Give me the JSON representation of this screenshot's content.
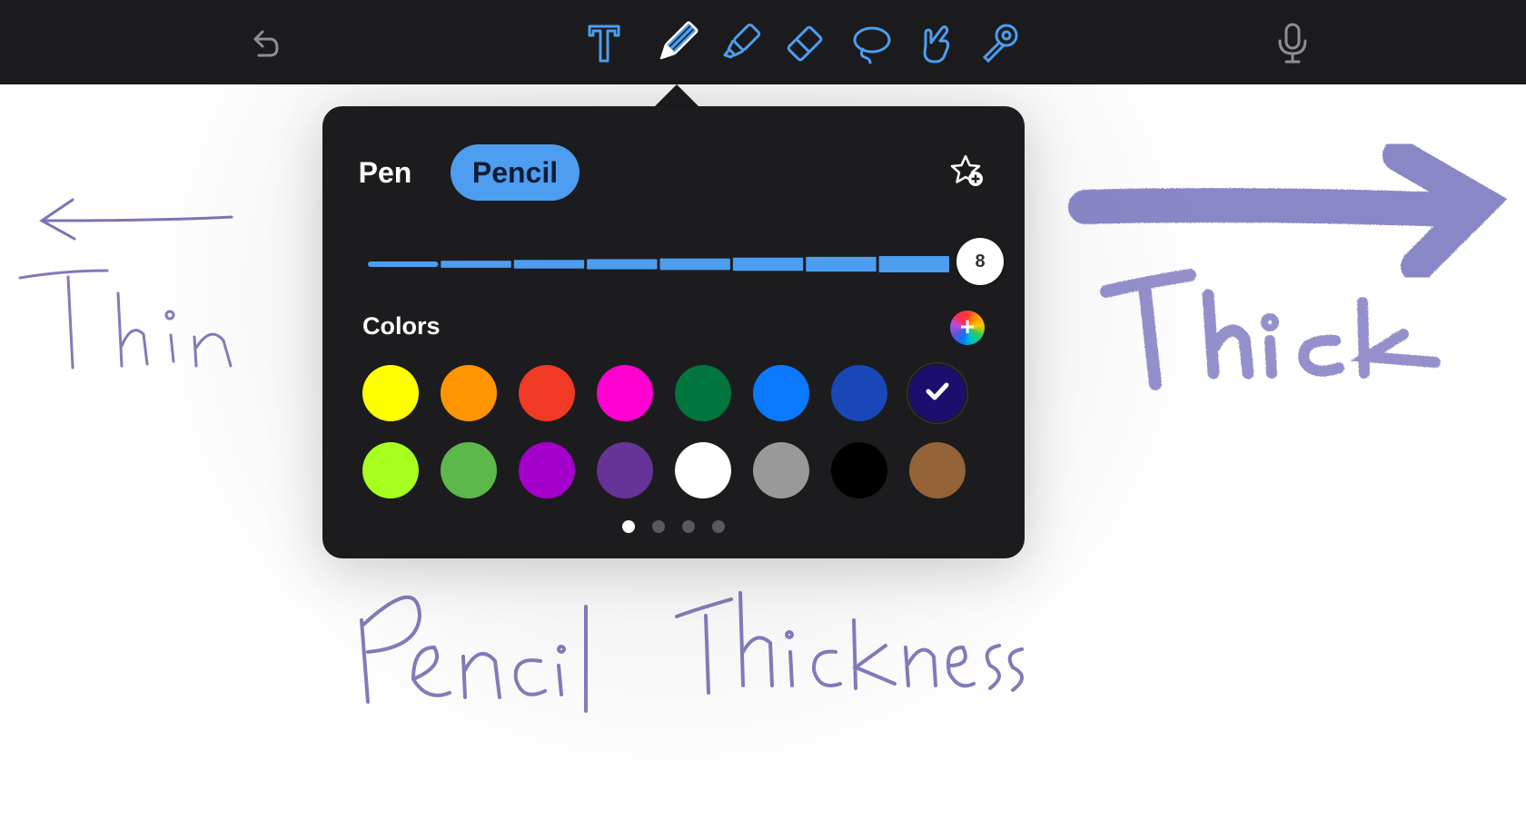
{
  "toolbar": {
    "items": [
      {
        "name": "undo-icon"
      },
      {
        "name": "text-tool-icon"
      },
      {
        "name": "pencil-tool-icon",
        "active": true
      },
      {
        "name": "highlighter-tool-icon"
      },
      {
        "name": "eraser-tool-icon"
      },
      {
        "name": "lasso-tool-icon"
      },
      {
        "name": "hand-tool-icon"
      },
      {
        "name": "laser-pointer-icon"
      },
      {
        "name": "microphone-icon"
      }
    ],
    "accent_color": "#4d9df0"
  },
  "popover": {
    "segments": {
      "pen": "Pen",
      "pencil": "Pencil",
      "selected": "pencil"
    },
    "favorite_icon": "star-plus-icon",
    "thickness": {
      "value": "8",
      "min": 1,
      "max": 8,
      "steps": 8
    },
    "colors_label": "Colors",
    "add_color_icon": "color-wheel-plus-icon",
    "swatches": [
      "#ffff00",
      "#ff9500",
      "#f03a24",
      "#ff00d0",
      "#00753d",
      "#0a78ff",
      "#1a47b8",
      "#1a0f6f",
      "#a6ff1f",
      "#5cb84a",
      "#a400cc",
      "#663399",
      "#ffffff",
      "#999999",
      "#000000",
      "#946338"
    ],
    "selected_swatch": 7,
    "page_dots": {
      "count": 4,
      "active": 0
    }
  },
  "canvas": {
    "handwriting": [
      "Thin",
      "Thick",
      "Pencil Thickness"
    ],
    "ink_color": "#5a55a6"
  }
}
